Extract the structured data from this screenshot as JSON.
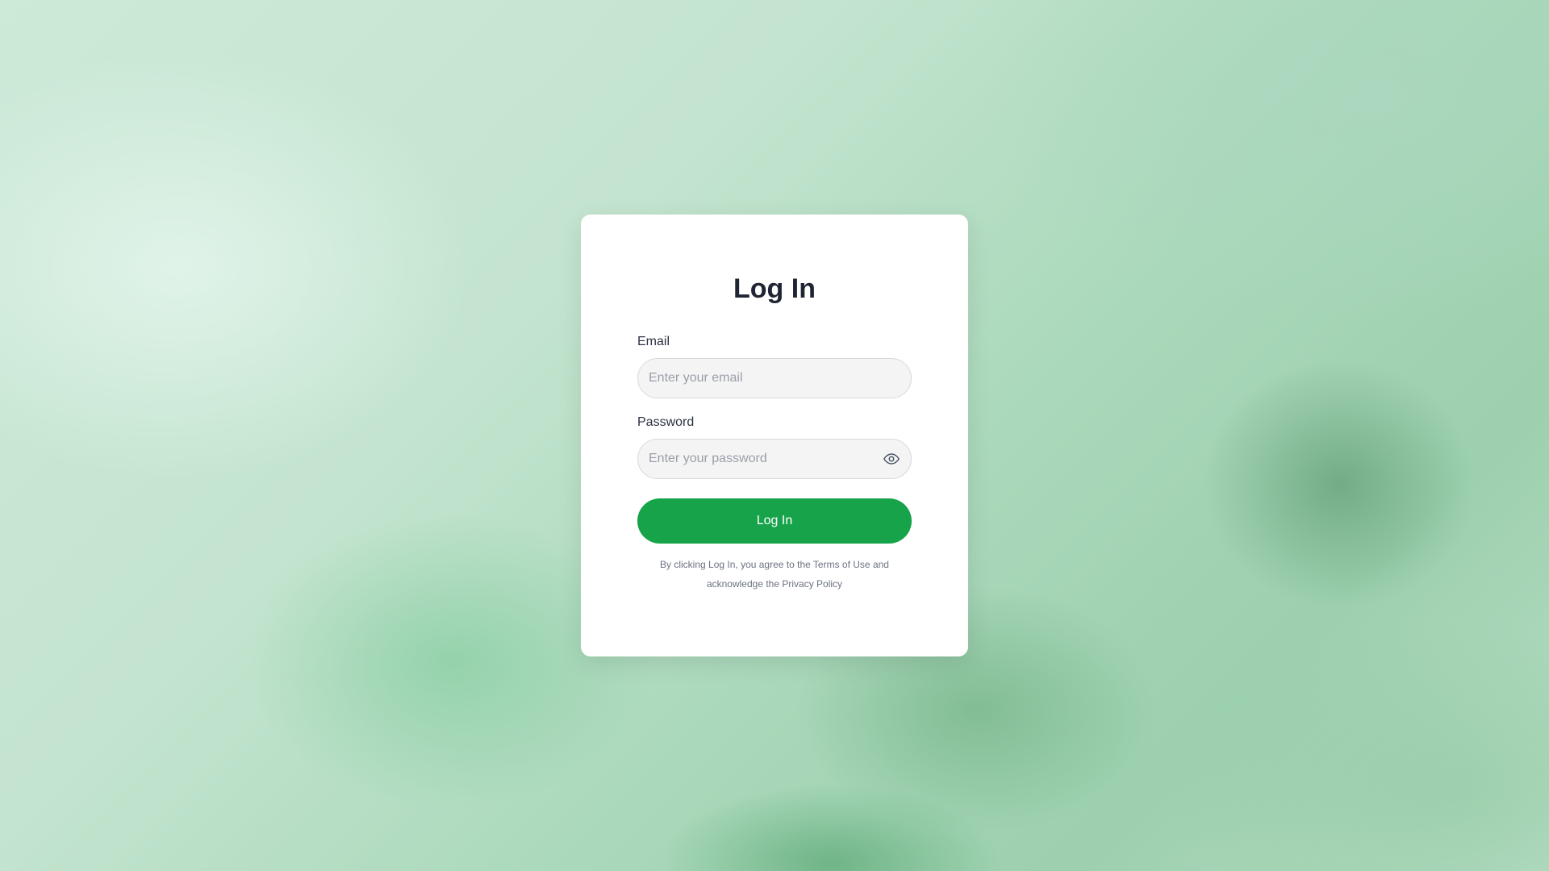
{
  "login": {
    "title": "Log In",
    "email_label": "Email",
    "email_placeholder": "Enter your email",
    "email_value": "",
    "password_label": "Password",
    "password_placeholder": "Enter your password",
    "password_value": "",
    "password_toggle_icon": "eye-icon",
    "submit_label": "Log In",
    "legal": {
      "prefix": "By clicking Log In, you agree to the ",
      "terms_link": "Terms of Use",
      "middle": " and",
      "line2_prefix": "acknowledge the ",
      "privacy_link": "Privacy Policy"
    }
  },
  "colors": {
    "primary_button": "#17a34a",
    "title_text": "#1f2533",
    "card_background": "#ffffff"
  }
}
